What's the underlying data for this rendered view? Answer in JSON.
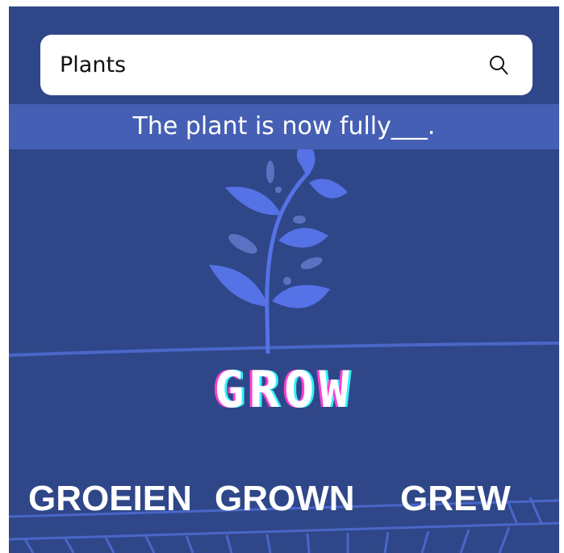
{
  "search": {
    "value": "Plants",
    "icon": "search-icon"
  },
  "question": {
    "text": "The plant is now fully___."
  },
  "word": {
    "title": "GROW"
  },
  "options": [
    {
      "label": "GROEIEN"
    },
    {
      "label": "GROWN"
    },
    {
      "label": "GREW"
    }
  ],
  "colors": {
    "background": "#2f4788",
    "band": "#445fb3",
    "plant": "#5572e6",
    "glitch_pink": "#ff3fd2",
    "glitch_cyan": "#36f0ff"
  }
}
